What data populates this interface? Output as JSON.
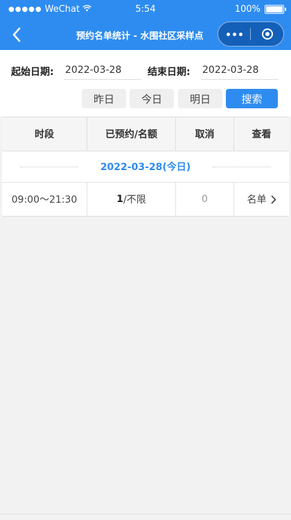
{
  "status_bar": {
    "carrier": "WeChat",
    "time": "5:54",
    "battery": "100%",
    "battery_level": 1.0
  },
  "nav": {
    "title": "预约名单统计 - 水围社区采样点",
    "back_icon": "chevron-left-icon",
    "more_icon": "more-dots-icon",
    "close_icon": "target-circle-icon"
  },
  "filter": {
    "start_label": "起始日期:",
    "start_value": "2022-03-28",
    "end_label": "结束日期:",
    "end_value": "2022-03-28",
    "buttons": {
      "yesterday": "昨日",
      "today": "今日",
      "tomorrow": "明日",
      "search": "搜索"
    }
  },
  "table": {
    "headers": [
      "时段",
      "已预约/名额",
      "取消",
      "查看"
    ],
    "date_group": "2022-03-28(今日)",
    "rows": [
      {
        "period": "09:00～21:30",
        "booked": "1",
        "quota": "/不限",
        "cancel": "0",
        "view": "名单"
      }
    ]
  },
  "colors": {
    "primary": "#2e8cf0",
    "background": "#f2f2f2",
    "muted": "#999999"
  }
}
